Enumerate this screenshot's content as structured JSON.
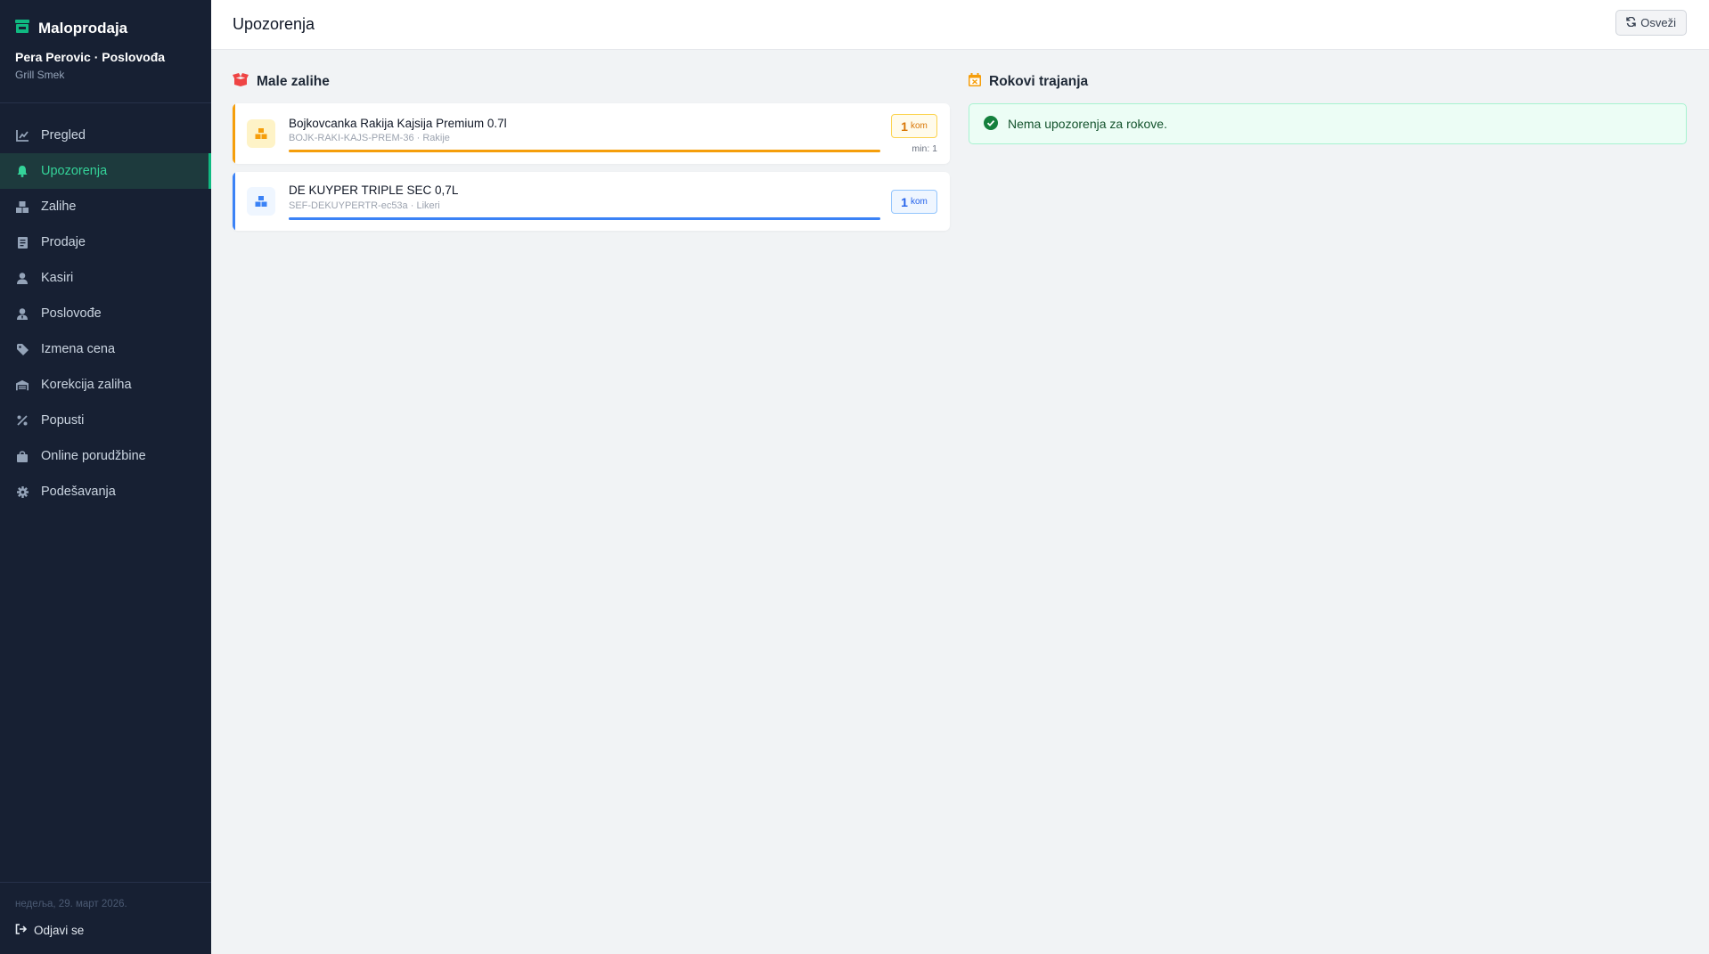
{
  "app": {
    "title": "Maloprodaja"
  },
  "user": {
    "name": "Pera Perovic · Poslovođa",
    "shop": "Grill Smek"
  },
  "nav": [
    {
      "label": "Pregled",
      "icon": "chart-line-icon",
      "active": false
    },
    {
      "label": "Upozorenja",
      "icon": "bell-icon",
      "active": true
    },
    {
      "label": "Zalihe",
      "icon": "boxes-icon",
      "active": false
    },
    {
      "label": "Prodaje",
      "icon": "receipt-icon",
      "active": false
    },
    {
      "label": "Kasiri",
      "icon": "user-icon",
      "active": false
    },
    {
      "label": "Poslovođe",
      "icon": "user-tie-icon",
      "active": false
    },
    {
      "label": "Izmena cena",
      "icon": "tag-icon",
      "active": false
    },
    {
      "label": "Korekcija zaliha",
      "icon": "warehouse-icon",
      "active": false
    },
    {
      "label": "Popusti",
      "icon": "percent-icon",
      "active": false
    },
    {
      "label": "Online porudžbine",
      "icon": "shopping-bag-icon",
      "active": false
    },
    {
      "label": "Podešavanja",
      "icon": "gear-icon",
      "active": false
    }
  ],
  "footer": {
    "date": "недеља, 29. март 2026.",
    "logout_label": "Odjavi se"
  },
  "header": {
    "title": "Upozorenja",
    "refresh_label": "Osveži"
  },
  "low_stock": {
    "title": "Male zalihe",
    "items": [
      {
        "name": "Bojkovcanka Rakija Kajsija Premium 0.7l",
        "meta": "BOJK-RAKI-KAJS-PREM-36 · Rakije",
        "qty": "1",
        "unit": "kom",
        "min": "min: 1",
        "level": 1.0,
        "color": "#f59e0b"
      },
      {
        "name": "DE KUYPER TRIPLE SEC 0,7L",
        "meta": "SEF-DEKUYPERTR-ec53a · Likeri",
        "qty": "1",
        "unit": "kom",
        "min": "",
        "level": 1.0,
        "color": "#3b82f6"
      }
    ]
  },
  "expiry": {
    "title": "Rokovi trajanja",
    "empty_message": "Nema upozorenja za rokove."
  },
  "colors": {
    "sidebar_bg": "#172033",
    "accent": "#10b981",
    "warning": "#f59e0b",
    "info": "#3b82f6",
    "danger": "#ef4444"
  }
}
